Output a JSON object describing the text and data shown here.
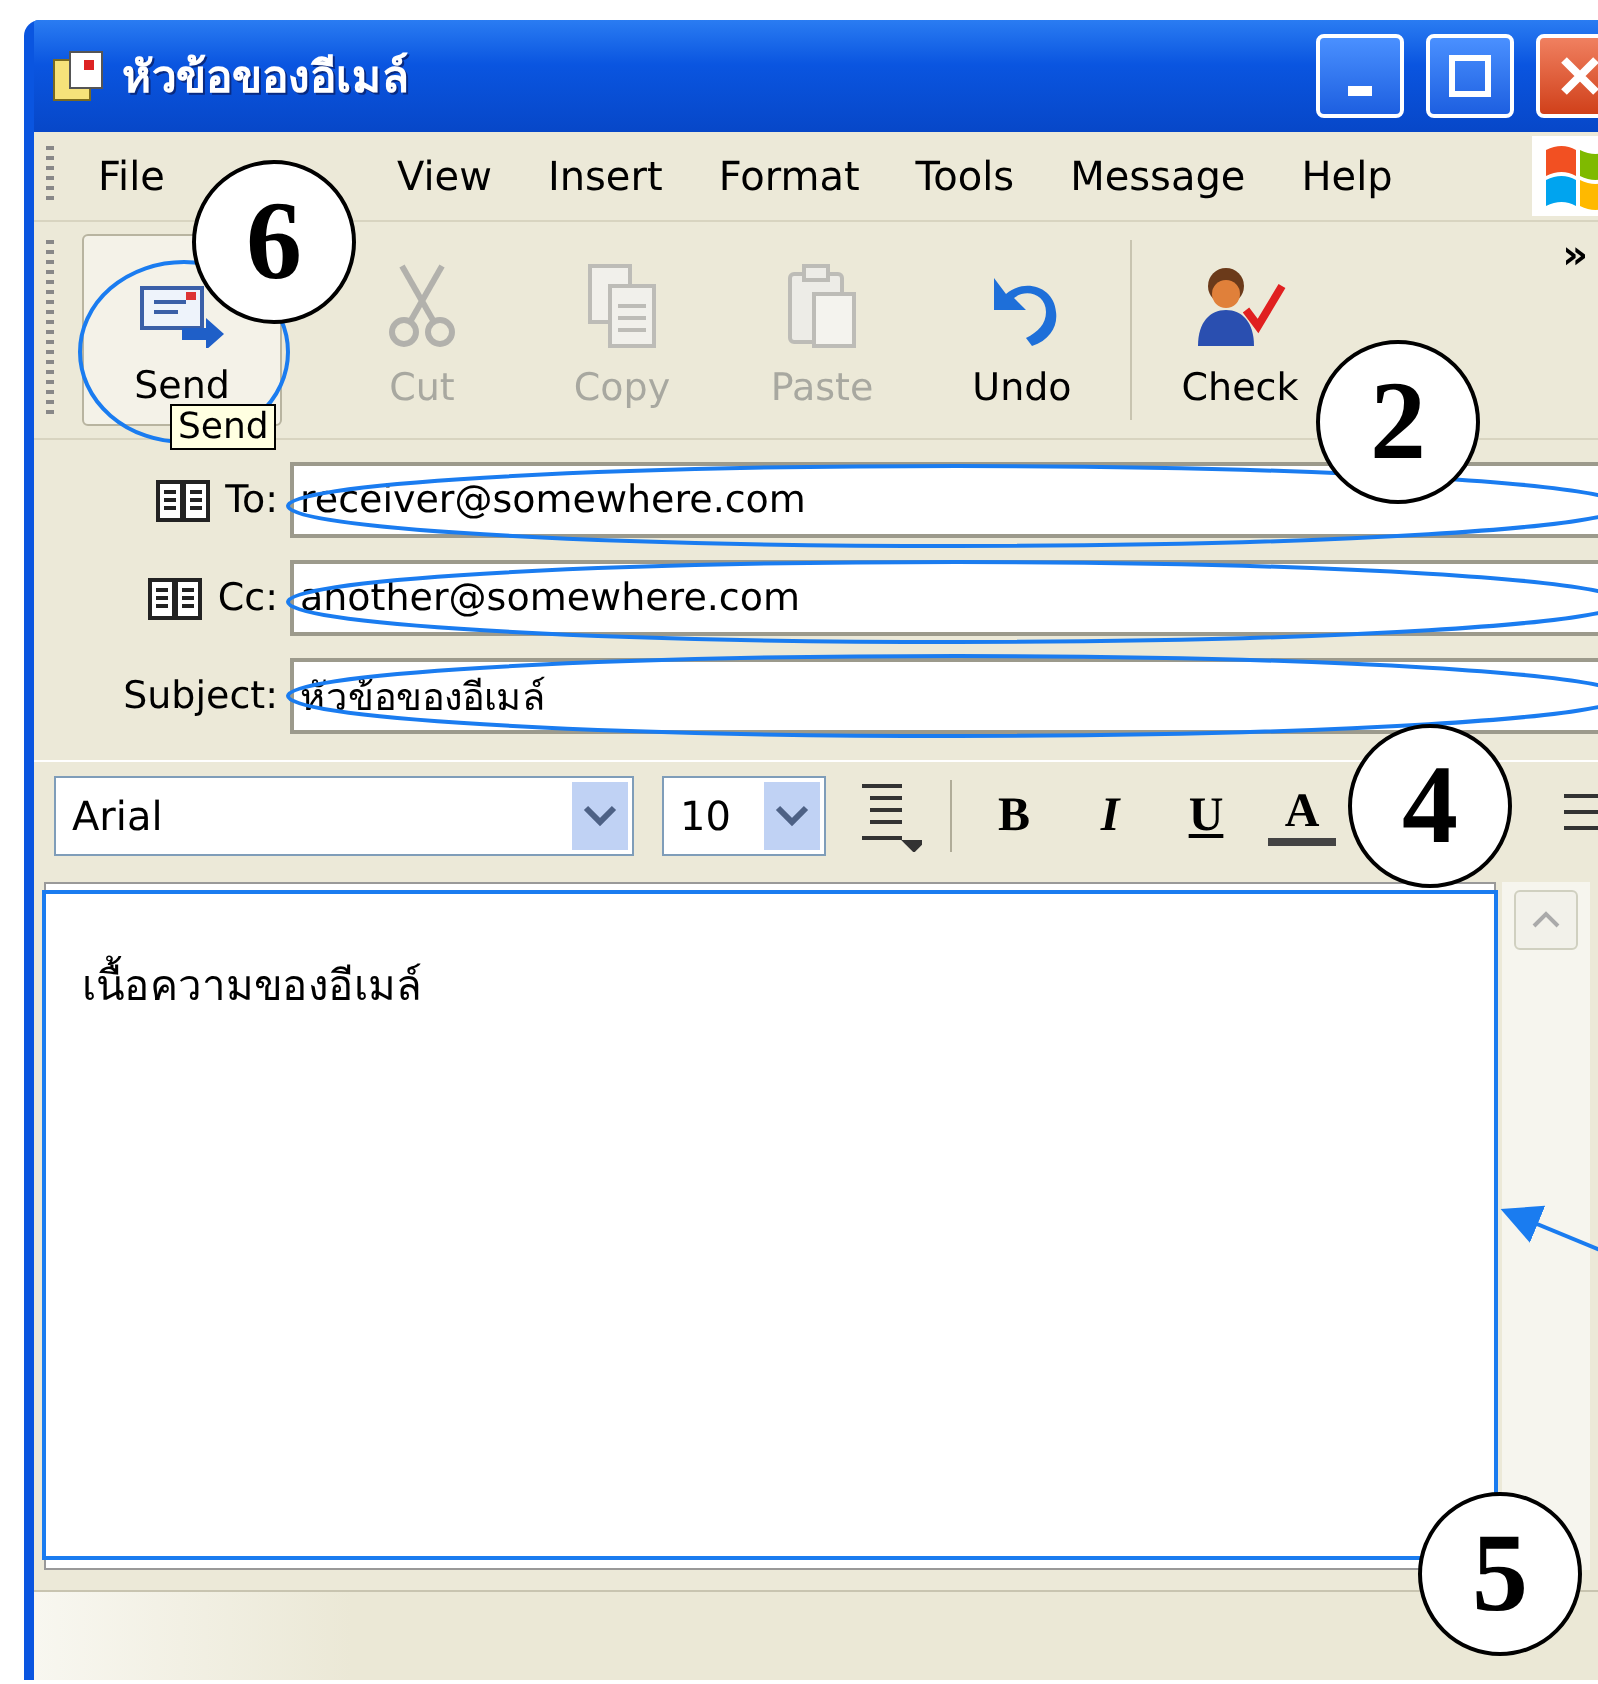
{
  "window": {
    "title": "หัวข้อของอีเมล์"
  },
  "menu": [
    {
      "label": "File"
    },
    {
      "label": "View"
    },
    {
      "label": "Insert"
    },
    {
      "label": "Format"
    },
    {
      "label": "Tools"
    },
    {
      "label": "Message"
    },
    {
      "label": "Help"
    }
  ],
  "toolbar": {
    "buttons": [
      {
        "label": "Send",
        "kind": "send",
        "disabled": false
      },
      {
        "label": "Cut",
        "kind": "cut",
        "disabled": true
      },
      {
        "label": "Copy",
        "kind": "copy",
        "disabled": true
      },
      {
        "label": "Paste",
        "kind": "paste",
        "disabled": true
      },
      {
        "label": "Undo",
        "kind": "undo",
        "disabled": false
      },
      {
        "label": "Check",
        "kind": "check",
        "disabled": false
      }
    ],
    "more": "»",
    "tooltip": "Send"
  },
  "fields": [
    {
      "label": "To:",
      "value": "receiver@somewhere.com",
      "kind": "address"
    },
    {
      "label": "Cc:",
      "value": "another@somewhere.com",
      "kind": "address"
    },
    {
      "label": "Subject:",
      "value": "หัวข้อของอีเมล์",
      "kind": "text"
    }
  ],
  "format_bar": {
    "font": "Arial",
    "size": "10",
    "buttons": [
      {
        "label": "B",
        "kind": "bold"
      },
      {
        "label": "I",
        "kind": "italic"
      },
      {
        "label": "U",
        "kind": "underline"
      },
      {
        "label": "A",
        "kind": "color"
      }
    ]
  },
  "body": {
    "text": "เนื้อความของอีเมล์"
  },
  "annotations": {
    "callouts": [
      "6",
      "2",
      "4",
      "5"
    ]
  }
}
